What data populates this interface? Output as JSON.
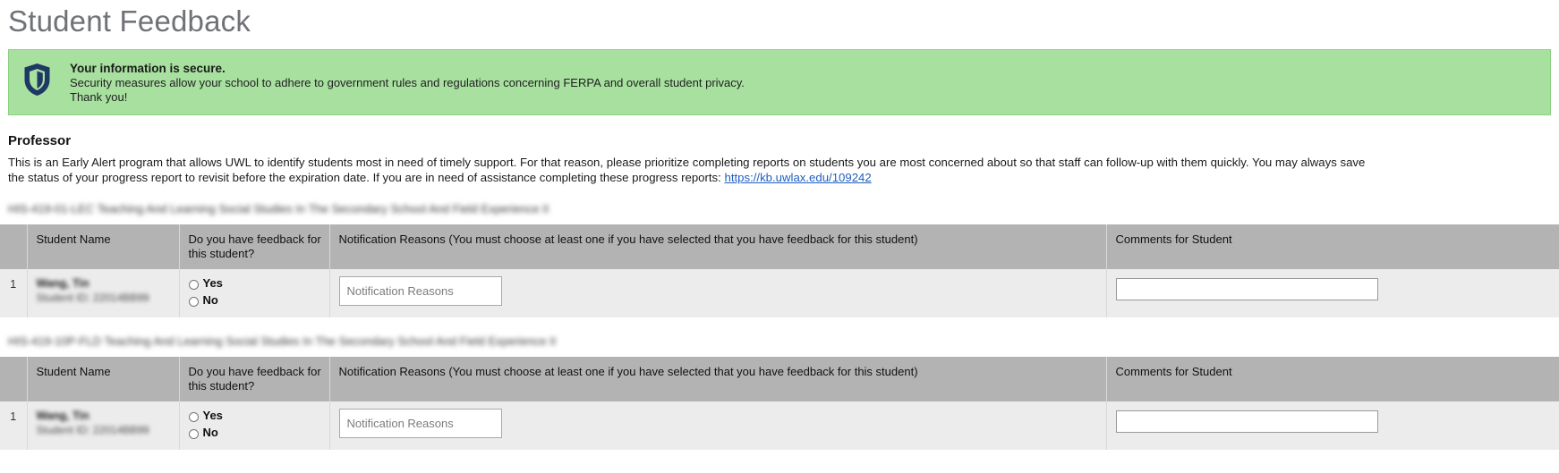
{
  "page": {
    "title": "Student Feedback"
  },
  "alert": {
    "icon": "shield-icon",
    "heading": "Your information is secure.",
    "line1": "Security measures allow your school to adhere to government rules and regulations concerning FERPA and overall student privacy.",
    "line2": "Thank you!",
    "bg_color": "#a8e0a0",
    "border_color": "#8ed083",
    "shield_color": "#1f3864"
  },
  "professor": {
    "heading": "Professor",
    "intro_before_link": "This is an Early Alert program that allows UWL to identify students most in need of timely support. For that reason, please prioritize completing reports on students you are most concerned about so that staff can follow-up with them quickly. You may always save the status of your progress report to revisit before the expiration date. If you are in need of assistance completing these progress reports: ",
    "link_text": "https://kb.uwlax.edu/109242",
    "link_color": "#1f5fbf"
  },
  "table_headers": {
    "index": "",
    "student_name": "Student Name",
    "feedback_question": "Do you have feedback for this student?",
    "notification_reasons": "Notification Reasons (You must choose at least one if you have selected that you have feedback for this student)",
    "comments": "Comments for Student"
  },
  "radio_options": {
    "yes": "Yes",
    "no": "No"
  },
  "inputs": {
    "reasons_placeholder": "Notification Reasons",
    "reasons_value": "",
    "comments_placeholder": "",
    "comments_value": ""
  },
  "courses": [
    {
      "title": "HIS-419-01-LEC Teaching And Learning Social Studies In The Secondary School And Field Experience II",
      "rows": [
        {
          "index": "1",
          "student_name": "Wang, Tin",
          "student_id": "Student ID: 22014BB99"
        }
      ]
    },
    {
      "title": "HIS-419-10P-FLD Teaching And Learning Social Studies In The Secondary School And Field Experience II",
      "rows": [
        {
          "index": "1",
          "student_name": "Wang, Tin",
          "student_id": "Student ID: 22014BB99"
        }
      ]
    }
  ]
}
